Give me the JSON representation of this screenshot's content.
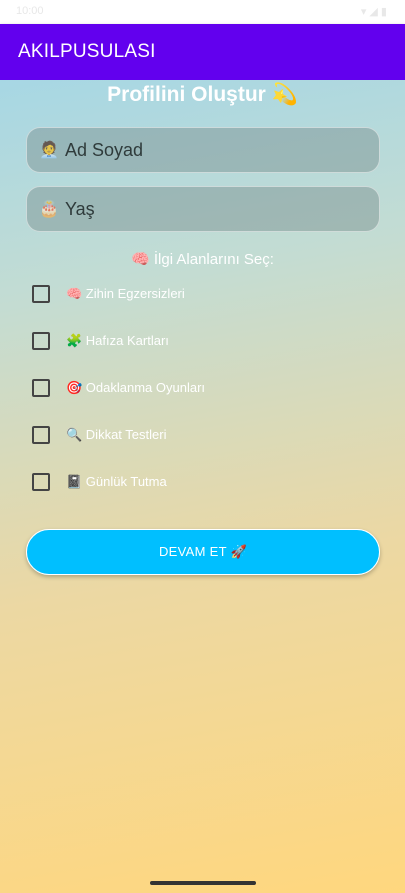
{
  "status_bar": {
    "time": "10:00",
    "system": "▾ ◢ ▮"
  },
  "app_bar": {
    "title": "AKILPUSULASI"
  },
  "profile": {
    "title": "Profilini Oluştur 💫",
    "name_field": {
      "icon": "🧑‍💼",
      "placeholder": "Ad Soyad"
    },
    "age_field": {
      "icon": "🎂",
      "placeholder": "Yaş"
    },
    "interests_label": "🧠 İlgi Alanlarını Seç:",
    "interests": [
      {
        "label": "🧠 Zihin Egzersizleri",
        "checked": false
      },
      {
        "label": "🧩 Hafıza Kartları",
        "checked": false
      },
      {
        "label": "🎯 Odaklanma Oyunları",
        "checked": false
      },
      {
        "label": "🔍 Dikkat Testleri",
        "checked": false
      },
      {
        "label": "📓 Günlük Tutma",
        "checked": false
      }
    ],
    "continue_label": "DEVAM ET 🚀"
  },
  "colors": {
    "app_bar": "#6200ee",
    "button": "#00bfff"
  }
}
